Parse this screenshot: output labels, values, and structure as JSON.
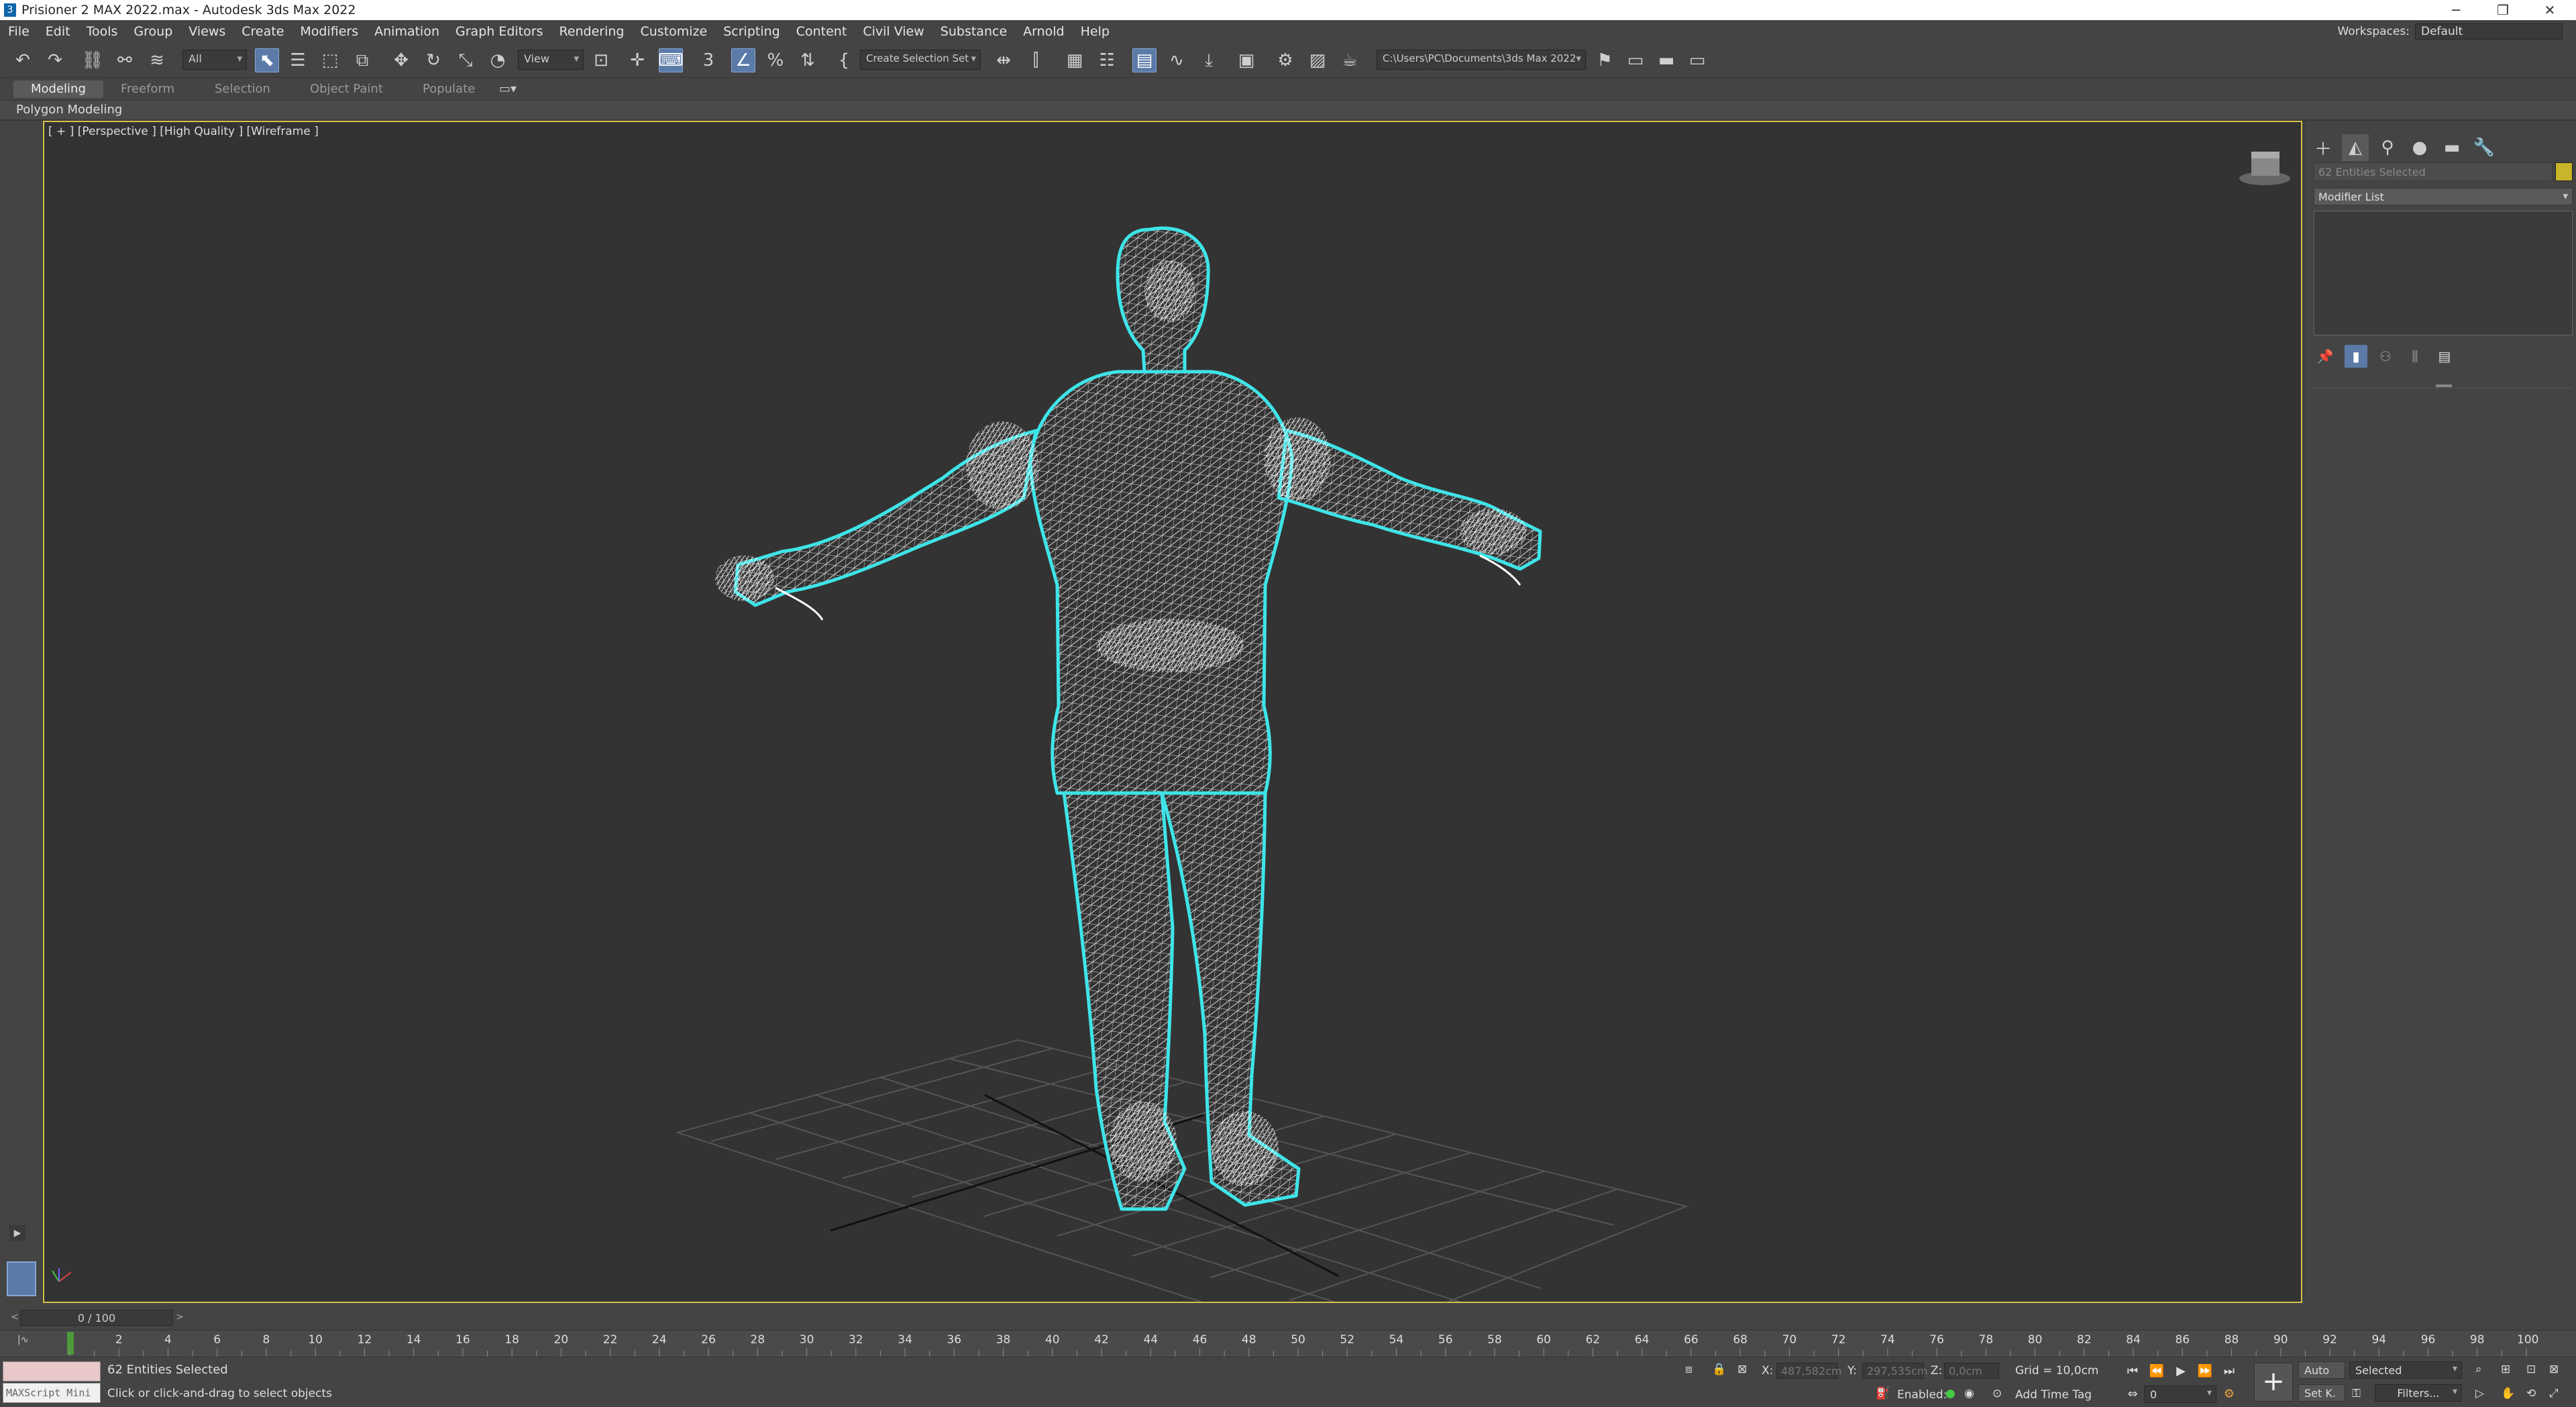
{
  "window": {
    "title": "Prisioner 2 MAX 2022.max - Autodesk 3ds Max 2022",
    "minimize_icon": "minimize-icon",
    "restore_icon": "restore-icon",
    "close_icon": "close-icon"
  },
  "menu": {
    "items": [
      "File",
      "Edit",
      "Tools",
      "Group",
      "Views",
      "Create",
      "Modifiers",
      "Animation",
      "Graph Editors",
      "Rendering",
      "Customize",
      "Scripting",
      "Content",
      "Civil View",
      "Substance",
      "Arnold",
      "Help"
    ],
    "workspaces_label": "Workspaces:",
    "workspaces_value": "Default"
  },
  "toolbar": {
    "selection_filter": "All",
    "ref_coord": "View",
    "selection_set": "Create Selection Set",
    "project_path": "C:\\Users\\PC\\Documents\\3ds Max 2022"
  },
  "ribbon": {
    "tabs": [
      "Modeling",
      "Freeform",
      "Selection",
      "Object Paint",
      "Populate"
    ],
    "active_tab": "Modeling",
    "sub_label": "Polygon Modeling"
  },
  "viewport": {
    "label": "[ + ] [Perspective ] [High Quality ] [Wireframe ]",
    "selection_color": "#3ee4e8",
    "border_color": "#d3c14b"
  },
  "command_panel": {
    "name_field": "62 Entities Selected",
    "modifier_list": "Modifier List"
  },
  "timeline": {
    "frame": "0 / 100",
    "ticks": [
      "2",
      "4",
      "6",
      "8",
      "10",
      "12",
      "14",
      "16",
      "18",
      "20",
      "22",
      "24",
      "26",
      "28",
      "30",
      "32",
      "34",
      "36",
      "38",
      "40",
      "42",
      "44",
      "46",
      "48",
      "50",
      "52",
      "54",
      "56",
      "58",
      "60",
      "62",
      "64",
      "66",
      "68",
      "70",
      "72",
      "74",
      "76",
      "78",
      "80",
      "82",
      "84",
      "86",
      "88",
      "90",
      "92",
      "94",
      "96",
      "98",
      "100"
    ]
  },
  "status": {
    "maxscript": "MAXScript Mini",
    "selection": "62 Entities Selected",
    "prompt": "Click or click-and-drag to select objects",
    "x_label": "X:",
    "x_value": "487,582cm",
    "y_label": "Y:",
    "y_value": "297,535cm",
    "z_label": "Z:",
    "z_value": "0,0cm",
    "grid": "Grid = 10,0cm",
    "enabled": "Enabled:",
    "add_time_tag": "Add Time Tag",
    "auto_key": "Auto",
    "set_key": "Set K.",
    "key_mode": "Selected",
    "frame_field": "0",
    "filters": "Filters..."
  }
}
